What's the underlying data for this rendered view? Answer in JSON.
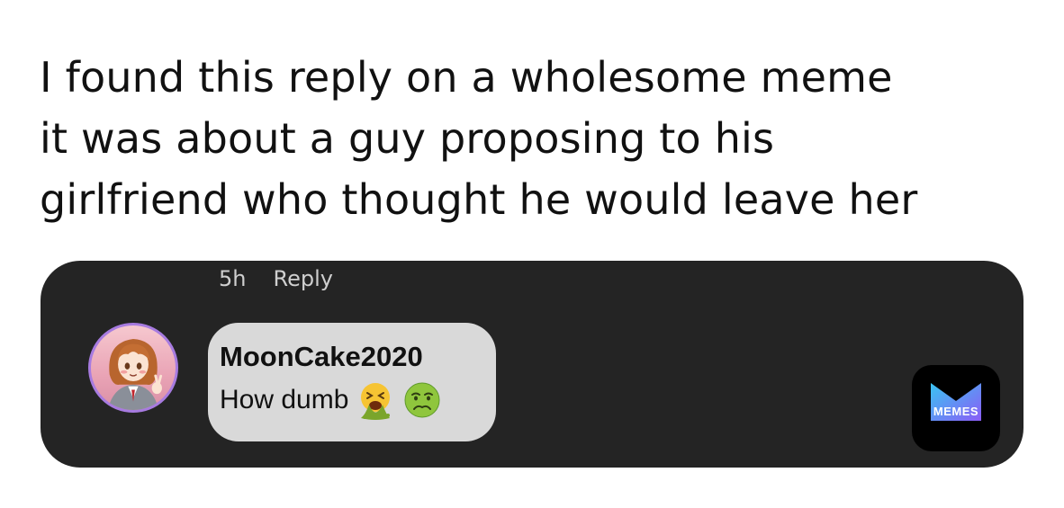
{
  "caption": {
    "lines": [
      "I found this reply on a wholesome meme",
      "it was about a guy proposing to his",
      "girlfriend who thought he would leave her"
    ]
  },
  "comment": {
    "time_ago": "5h",
    "reply_label": "Reply",
    "username": "MoonCake2020",
    "text": "How dumb",
    "emojis": [
      "vomiting-face-emoji",
      "nauseated-face-emoji"
    ],
    "avatar": "anime-girl-avatar"
  },
  "watermark": {
    "label": "MEMES",
    "icon": "memes-m-logo"
  },
  "colors": {
    "panel_bg": "#242424",
    "bubble_bg": "#d9d9d9",
    "avatar_ring": "#a77be0",
    "meta_text": "#cfcfcf"
  }
}
